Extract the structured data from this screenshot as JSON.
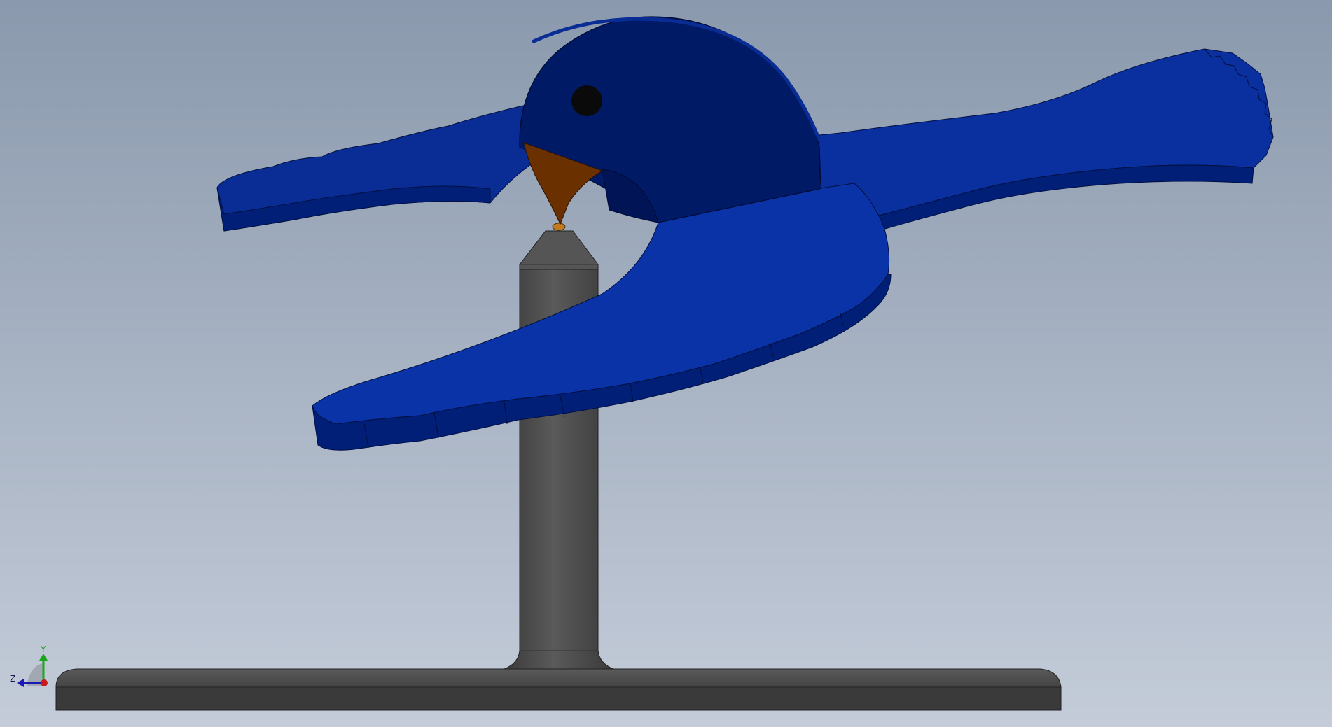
{
  "viewport": {
    "background_top": "#8a99ad",
    "background_bottom": "#c4ccd9"
  },
  "model": {
    "parts": [
      {
        "name": "bird-body",
        "color": "#0a2a8f"
      },
      {
        "name": "bird-head",
        "color": "#001a66"
      },
      {
        "name": "bird-beak",
        "color": "#6b3000"
      },
      {
        "name": "stand-pole",
        "color": "#4a4a4a"
      },
      {
        "name": "stand-base",
        "color": "#3e3e3e"
      }
    ]
  },
  "triad": {
    "y_label": "Y",
    "z_label": "Z",
    "y_color": "#1aa61a",
    "z_color": "#1a1ab3",
    "x_color": "#cc1a1a",
    "icon": "coordinate-triad-icon"
  }
}
